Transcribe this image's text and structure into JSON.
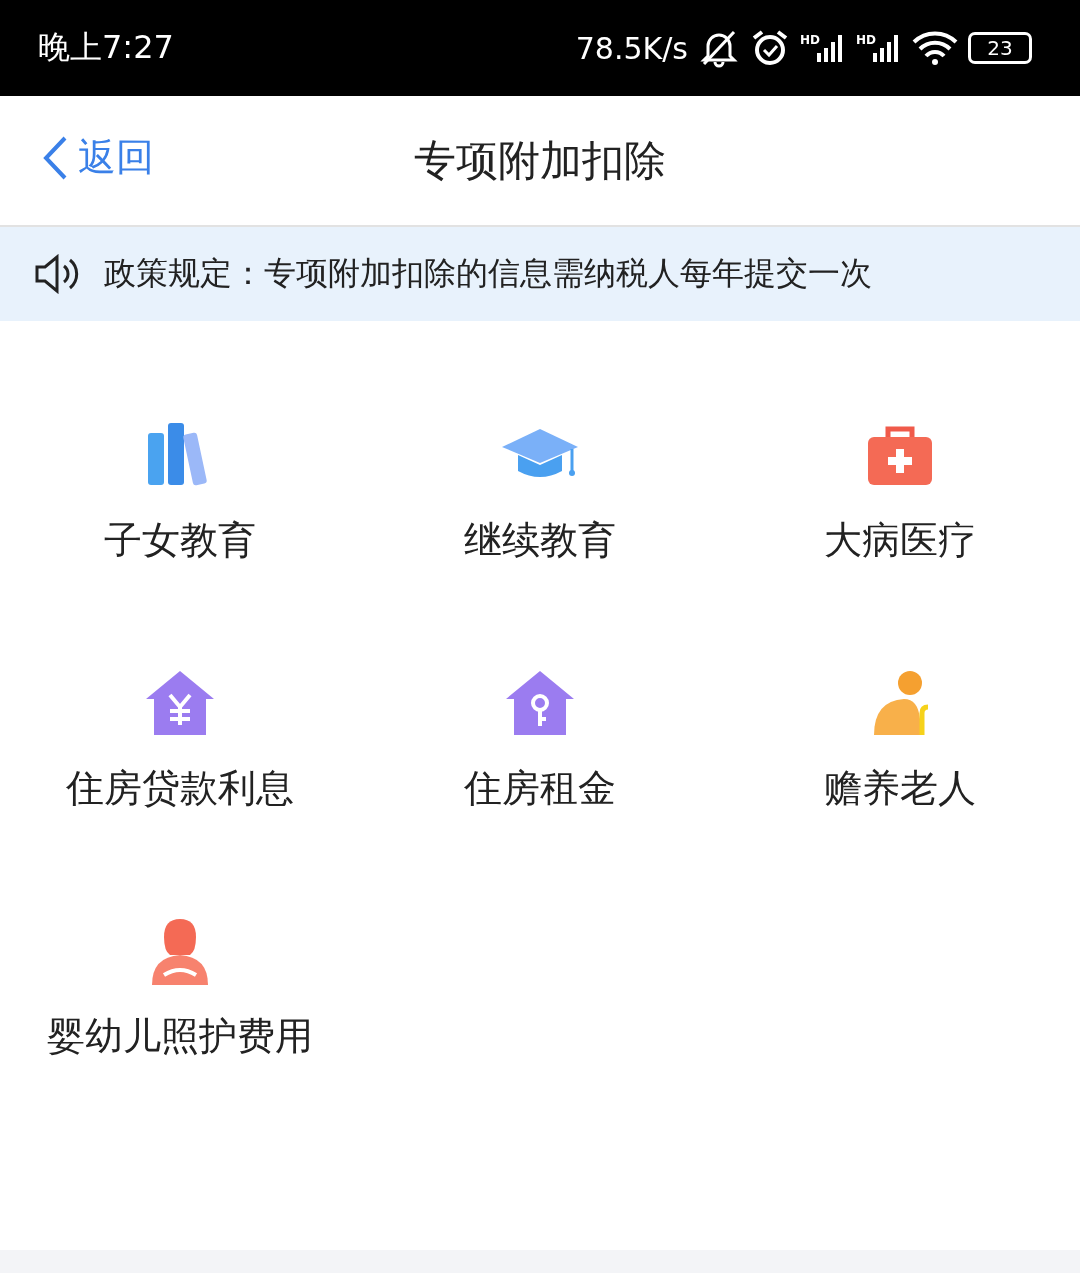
{
  "status_bar": {
    "time": "晚上7:27",
    "network_speed": "78.5K/s",
    "signal_labels": [
      "HD",
      "HD"
    ],
    "battery": "23"
  },
  "header": {
    "back": "返回",
    "title": "专项附加扣除"
  },
  "notice": {
    "text": "政策规定：专项附加扣除的信息需纳税人每年提交一次"
  },
  "items": [
    {
      "label": "子女教育",
      "kind": "books"
    },
    {
      "label": "继续教育",
      "kind": "cap"
    },
    {
      "label": "大病医疗",
      "kind": "medkit"
    },
    {
      "label": "住房贷款利息",
      "kind": "house-yen"
    },
    {
      "label": "住房租金",
      "kind": "house-key"
    },
    {
      "label": "赡养老人",
      "kind": "elder"
    },
    {
      "label": "婴幼儿照护费用",
      "kind": "mother"
    }
  ]
}
